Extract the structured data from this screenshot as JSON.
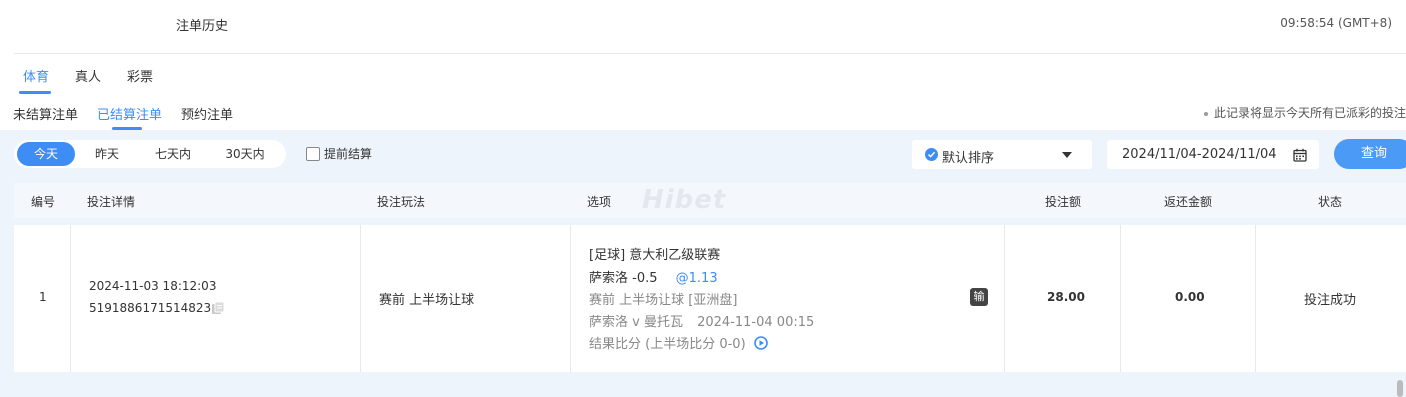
{
  "header": {
    "title": "注单历史",
    "clock": "09:58:54 (GMT+8)"
  },
  "tabs": [
    {
      "label": "体育",
      "active": true
    },
    {
      "label": "真人",
      "active": false
    },
    {
      "label": "彩票",
      "active": false
    }
  ],
  "subtabs": [
    {
      "label": "未结算注单",
      "active": false
    },
    {
      "label": "已结算注单",
      "active": true
    },
    {
      "label": "预约注单",
      "active": false
    }
  ],
  "note": "此记录将显示今天所有已派彩的投注",
  "filters": {
    "date_pills": [
      "今天",
      "昨天",
      "七天内",
      "30天内"
    ],
    "active_pill": "今天",
    "early_settle_label": "提前结算",
    "early_settle_checked": false,
    "sort_label": "默认排序",
    "date_range": "2024/11/04-2024/11/04",
    "query_label": "查询"
  },
  "table": {
    "columns": [
      "编号",
      "投注详情",
      "投注玩法",
      "选项",
      "投注额",
      "返还金额",
      "状态"
    ],
    "rows": [
      {
        "index": "1",
        "bet_time": "2024-11-03 18:12:03",
        "bet_id": "5191886171514823",
        "play_type": "赛前   上半场让球",
        "league": "[足球] 意大利乙级联赛",
        "selection": "萨索洛 -0.5",
        "odds": "@1.13",
        "market": "赛前 上半场让球 [亚洲盘]",
        "match": "萨索洛 v 曼托瓦",
        "match_time": "2024-11-04 00:15",
        "result": "结果比分 (上半场比分 0-0)",
        "result_badge": "输",
        "stake": "28.00",
        "return": "0.00",
        "status": "投注成功"
      }
    ]
  },
  "watermark": "Hibet",
  "colors": {
    "accent": "#3d8df5",
    "filter_bg": "#eef4fc",
    "header_bg": "#f4f8fd"
  }
}
